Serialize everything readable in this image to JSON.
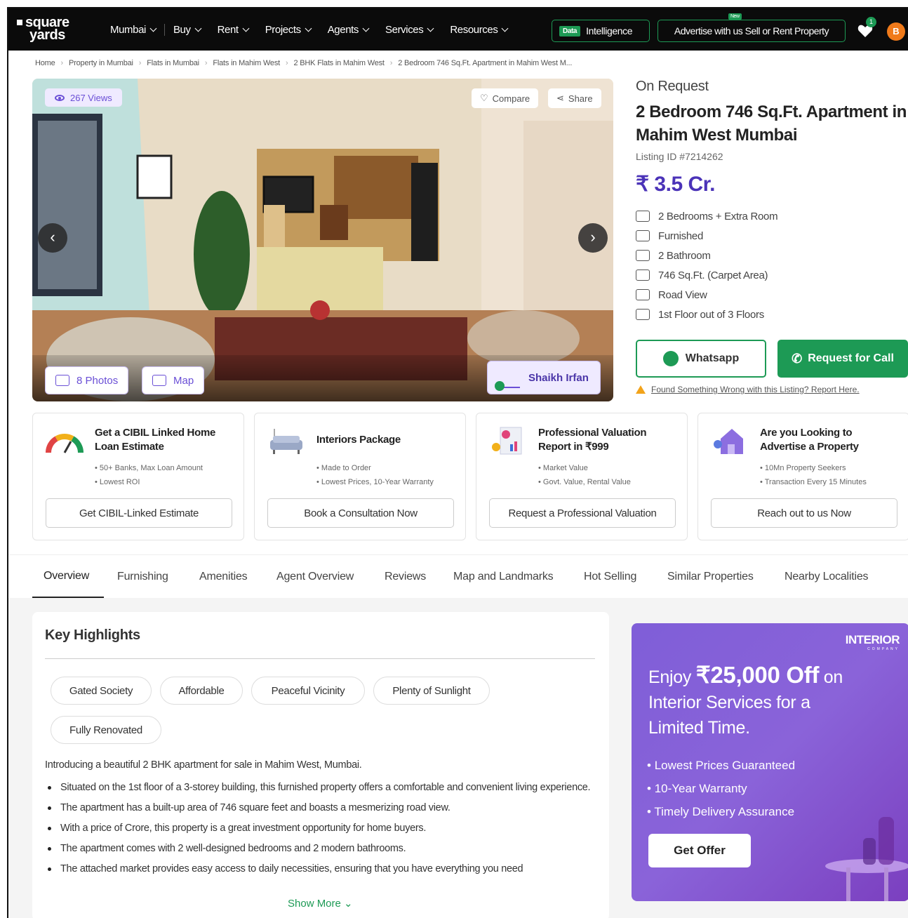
{
  "nav": {
    "logo_line1": "square",
    "logo_line2": "yards",
    "menu": [
      "Mumbai",
      "Buy",
      "Rent",
      "Projects",
      "Agents",
      "Services",
      "Resources"
    ],
    "data_tag": "Data",
    "data_label": "Intelligence",
    "advertise": "Advertise with us Sell or Rent Property",
    "new_tag": "New",
    "fav_count": "1",
    "avatar_letter": "B"
  },
  "breadcrumb": [
    "Home",
    "Property in Mumbai",
    "Flats in Mumbai",
    "Flats in Mahim West",
    "2 BHK Flats in Mahim West",
    "2 Bedroom 746 Sq.Ft. Apartment in Mahim West M..."
  ],
  "gallery": {
    "views": "267 Views",
    "compare": "Compare",
    "share": "Share",
    "photos": "8 Photos",
    "map": "Map",
    "agent": "Shaikh Irfan"
  },
  "listing": {
    "status": "On Request",
    "title": "2 Bedroom 746 Sq.Ft. Apartment in Mahim West Mumbai",
    "listing_id": "Listing ID #7214262",
    "price": "₹ 3.5 Cr.",
    "features": [
      {
        "icon": "bed-icon",
        "text": "2 Bedrooms + Extra Room"
      },
      {
        "icon": "sofa-icon",
        "text": "Furnished"
      },
      {
        "icon": "bathtub-icon",
        "text": "2 Bathroom"
      },
      {
        "icon": "area-icon",
        "text": "746 Sq.Ft. (Carpet Area)"
      },
      {
        "icon": "view-icon",
        "text": "Road View"
      },
      {
        "icon": "floor-icon",
        "text": "1st Floor out of 3 Floors"
      }
    ],
    "whatsapp": "Whatsapp",
    "call": "Request for Call",
    "report": "Found Something Wrong with this Listing? Report Here."
  },
  "services": [
    {
      "title": "Get a CIBIL Linked Home Loan Estimate",
      "bullets": [
        "50+ Banks, Max Loan Amount",
        "Lowest ROI"
      ],
      "button": "Get CIBIL-Linked Estimate",
      "icon": "gauge-icon"
    },
    {
      "title": "Interiors Package",
      "bullets": [
        "Made to Order",
        "Lowest Prices, 10-Year Warranty"
      ],
      "button": "Book a Consultation Now",
      "icon": "sofa-lamp-icon"
    },
    {
      "title": "Professional Valuation Report in ₹999",
      "bullets": [
        "Market Value",
        "Govt. Value, Rental Value"
      ],
      "button": "Request a Professional Valuation",
      "icon": "report-chart-icon"
    },
    {
      "title": "Are you Looking to Advertise a Property",
      "bullets": [
        "10Mn Property Seekers",
        "Transaction Every 15 Minutes"
      ],
      "button": "Reach out to us Now",
      "icon": "house-megaphone-icon"
    }
  ],
  "tabs": [
    "Overview",
    "Furnishing",
    "Amenities",
    "Agent Overview",
    "Reviews",
    "Map and Landmarks",
    "Hot Selling",
    "Similar Properties",
    "Nearby Localities"
  ],
  "highlights": {
    "title": "Key Highlights",
    "chips": [
      "Gated Society",
      "Affordable",
      "Peaceful Vicinity",
      "Plenty of Sunlight",
      "Fully Renovated"
    ],
    "intro": "Introducing a beautiful 2 BHK apartment for sale in Mahim West, Mumbai.",
    "bullets": [
      "Situated on the 1st floor of a 3-storey building, this furnished property offers a comfortable and convenient living experience.",
      "The apartment has a built-up area of 746 square feet and boasts a mesmerizing road view.",
      "With a price of Crore, this property is a great investment opportunity for home buyers.",
      "The apartment comes with 2 well-designed bedrooms and 2 modern bathrooms.",
      "The attached market provides easy access to daily necessities, ensuring that you have everything you need"
    ],
    "show_more": "Show More"
  },
  "promo": {
    "brand": "INTERIOR",
    "brand_sub": "COMPANY",
    "head_pre": "Enjoy ",
    "head_big": "₹25,000 Off",
    "head_post": " on Interior Services for a Limited Time.",
    "points": [
      "Lowest Prices Guaranteed",
      "10-Year Warranty",
      "Timely Delivery Assurance"
    ],
    "button": "Get Offer"
  },
  "colors": {
    "brand_green": "#1d9a55",
    "price_purple": "#4b33b8",
    "nav_bg": "#0b0b0b"
  }
}
